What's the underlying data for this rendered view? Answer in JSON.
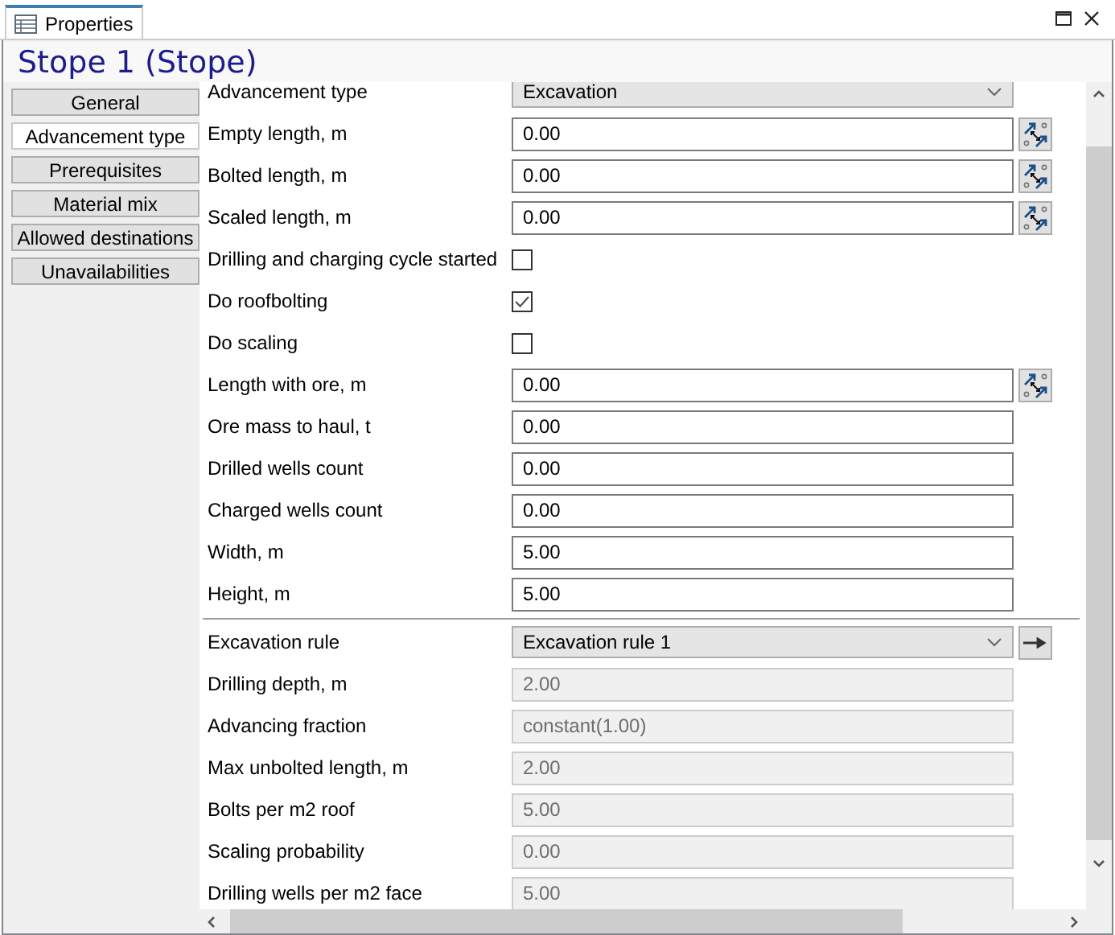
{
  "tab": {
    "label": "Properties"
  },
  "title": "Stope 1 (Stope)",
  "nav": [
    {
      "label": "General",
      "selected": false
    },
    {
      "label": "Advancement type",
      "selected": true
    },
    {
      "label": "Prerequisites",
      "selected": false
    },
    {
      "label": "Material mix",
      "selected": false
    },
    {
      "label": "Allowed destinations",
      "selected": false
    },
    {
      "label": "Unavailabilities",
      "selected": false
    }
  ],
  "rows": [
    {
      "kind": "dropdown",
      "label": "Advancement type",
      "value": "Excavation",
      "has_button": false
    },
    {
      "kind": "number",
      "label": "Empty length, m",
      "value": "0.00",
      "has_button": true
    },
    {
      "kind": "number",
      "label": "Bolted length, m",
      "value": "0.00",
      "has_button": true
    },
    {
      "kind": "number",
      "label": "Scaled length, m",
      "value": "0.00",
      "has_button": true
    },
    {
      "kind": "checkbox",
      "label": "Drilling and charging cycle started",
      "checked": false
    },
    {
      "kind": "checkbox",
      "label": "Do roofbolting",
      "checked": true
    },
    {
      "kind": "checkbox",
      "label": "Do scaling",
      "checked": false
    },
    {
      "kind": "number",
      "label": "Length with ore, m",
      "value": "0.00",
      "has_button": true
    },
    {
      "kind": "number",
      "label": "Ore mass to haul, t",
      "value": "0.00",
      "has_button": false
    },
    {
      "kind": "number",
      "label": "Drilled wells count",
      "value": "0.00",
      "has_button": false
    },
    {
      "kind": "number",
      "label": "Charged wells count",
      "value": "0.00",
      "has_button": false
    },
    {
      "kind": "number",
      "label": "Width, m",
      "value": "5.00",
      "has_button": false
    },
    {
      "kind": "number",
      "label": "Height, m",
      "value": "5.00",
      "has_button": false
    },
    {
      "kind": "separator"
    },
    {
      "kind": "dropdown",
      "label": "Excavation rule",
      "value": "Excavation rule 1",
      "has_button": true
    },
    {
      "kind": "readonly",
      "label": "Drilling depth, m",
      "value": "2.00"
    },
    {
      "kind": "readonly",
      "label": "Advancing fraction",
      "value": "constant(1.00)"
    },
    {
      "kind": "readonly",
      "label": "Max unbolted length, m",
      "value": "2.00"
    },
    {
      "kind": "readonly",
      "label": "Bolts per m2 roof",
      "value": "5.00"
    },
    {
      "kind": "readonly",
      "label": "Scaling probability",
      "value": "0.00"
    },
    {
      "kind": "readonly",
      "label": "Drilling wells per m2 face",
      "value": "5.00"
    }
  ]
}
